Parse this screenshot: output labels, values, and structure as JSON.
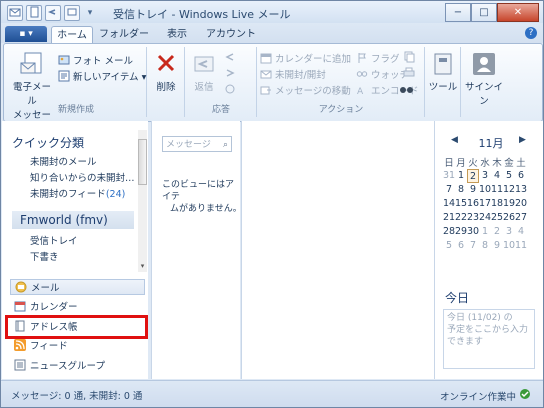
{
  "window": {
    "title": "受信トレイ - Windows Live メール"
  },
  "window_controls": {
    "minimize": "−",
    "maximize": "□",
    "close": "✕"
  },
  "tabs": [
    {
      "label": "ホーム"
    },
    {
      "label": "フォルダー"
    },
    {
      "label": "表示"
    },
    {
      "label": "アカウント"
    }
  ],
  "app_button": {
    "label": "▪ ▾"
  },
  "help_label": "?",
  "ribbon": {
    "new": {
      "email": "電子メール",
      "message": "メッセージ",
      "photo_mail": "フォト メール",
      "new_items": "新しいアイテム ▾",
      "group_label": "新規作成"
    },
    "delete": {
      "label": "削除"
    },
    "respond": {
      "reply": "返信",
      "group_label": "応答"
    },
    "actions": {
      "add_to_calendar": "カレンダーに追加",
      "flag": "フラグ",
      "unread_read": "未開封/開封",
      "watch": "ウォッチ",
      "move_message": "メッセージの移動",
      "encode": "エンコード",
      "group_label": "アクション"
    },
    "tools": {
      "label": "ツール"
    },
    "signin": {
      "label": "サインイン"
    }
  },
  "quick_views": {
    "heading": "クイック分類",
    "items": [
      {
        "label": "未開封のメール"
      },
      {
        "label": "知り合いからの未開封…"
      },
      {
        "label": "未開封のフィード",
        "count": "(24)"
      }
    ]
  },
  "account": {
    "name": "Fmworld (fmv)",
    "folders": [
      {
        "label": "受信トレイ"
      },
      {
        "label": "下書き"
      }
    ]
  },
  "bottom_nav": [
    {
      "label": "メール"
    },
    {
      "label": "カレンダー"
    },
    {
      "label": "アドレス帳"
    },
    {
      "label": "フィード"
    },
    {
      "label": "ニュースグループ"
    }
  ],
  "search": {
    "placeholder": "メッセージ"
  },
  "message_list": {
    "empty_line1": "このビューにはアイテ",
    "empty_line2": "ムがありません。"
  },
  "calendar": {
    "month": "11月",
    "dow": [
      "日",
      "月",
      "火",
      "水",
      "木",
      "金",
      "土"
    ],
    "weeks": [
      [
        "31",
        "1",
        "2",
        "3",
        "4",
        "5",
        "6"
      ],
      [
        "7",
        "8",
        "9",
        "10",
        "11",
        "12",
        "13"
      ],
      [
        "14",
        "15",
        "16",
        "17",
        "18",
        "19",
        "20"
      ],
      [
        "21",
        "22",
        "23",
        "24",
        "25",
        "26",
        "27"
      ],
      [
        "28",
        "29",
        "30",
        "1",
        "2",
        "3",
        "4"
      ],
      [
        "5",
        "6",
        "7",
        "8",
        "9",
        "10",
        "11"
      ]
    ],
    "today_heading": "今日",
    "today_line1": "今日 (11/02) の",
    "today_line2": "予定をここから入力",
    "today_line3": "できます"
  },
  "status": {
    "left": "メッセージ: 0 通, 未開封: 0 通",
    "right": "オンライン作業中"
  }
}
